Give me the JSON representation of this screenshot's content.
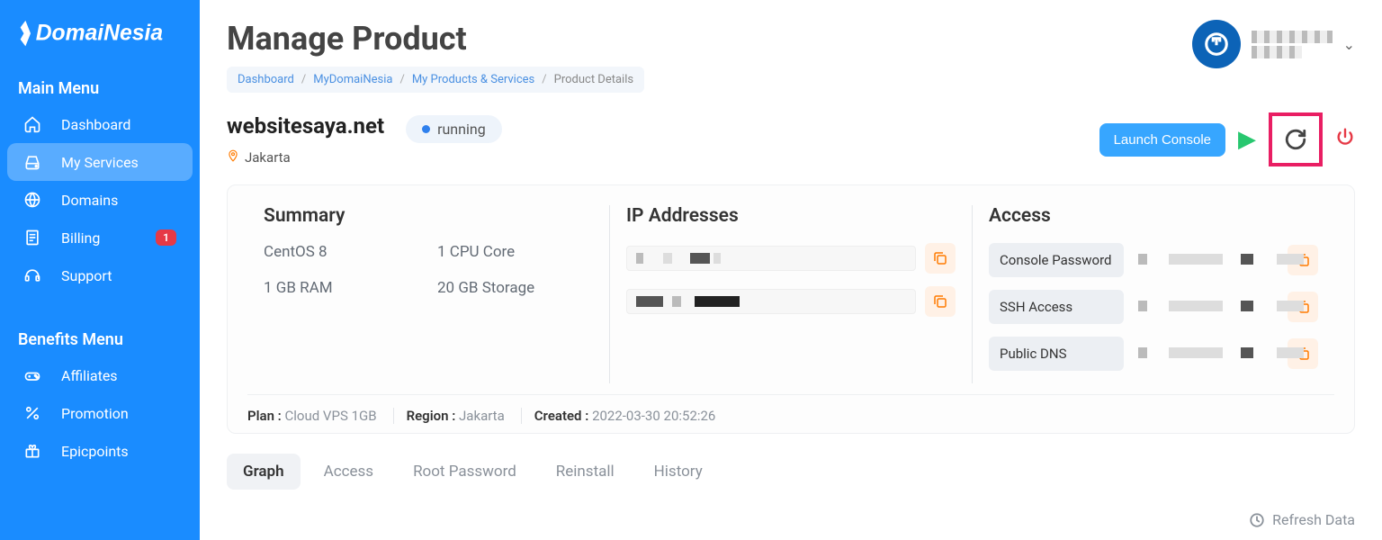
{
  "brand": "DomaiNesia",
  "sidebar": {
    "section1": "Main Menu",
    "items1": [
      {
        "icon": "home",
        "label": "Dashboard"
      },
      {
        "icon": "drive",
        "label": "My Services",
        "active": true
      },
      {
        "icon": "globe",
        "label": "Domains"
      },
      {
        "icon": "bill",
        "label": "Billing",
        "badge": "1"
      },
      {
        "icon": "headset",
        "label": "Support"
      }
    ],
    "section2": "Benefits Menu",
    "items2": [
      {
        "icon": "gamepad",
        "label": "Affiliates"
      },
      {
        "icon": "percent",
        "label": "Promotion"
      },
      {
        "icon": "gift",
        "label": "Epicpoints"
      }
    ]
  },
  "page": {
    "title": "Manage Product",
    "breadcrumb": [
      "Dashboard",
      "MyDomaiNesia",
      "My Products & Services",
      "Product Details"
    ]
  },
  "product": {
    "name": "websitesaya.net",
    "status": "running",
    "location": "Jakarta",
    "launch_console": "Launch Console"
  },
  "summary": {
    "title": "Summary",
    "os": "CentOS 8",
    "cpu": "1 CPU Core",
    "ram": "1 GB RAM",
    "storage": "20 GB Storage"
  },
  "ip": {
    "title": "IP Addresses"
  },
  "access": {
    "title": "Access",
    "rows": [
      "Console Password",
      "SSH Access",
      "Public DNS"
    ]
  },
  "meta": {
    "plan_k": "Plan :",
    "plan_v": "Cloud VPS 1GB",
    "region_k": "Region :",
    "region_v": "Jakarta",
    "created_k": "Created :",
    "created_v": "2022-03-30 20:52:26"
  },
  "tabs": [
    "Graph",
    "Access",
    "Root Password",
    "Reinstall",
    "History"
  ],
  "refresh": "Refresh Data"
}
